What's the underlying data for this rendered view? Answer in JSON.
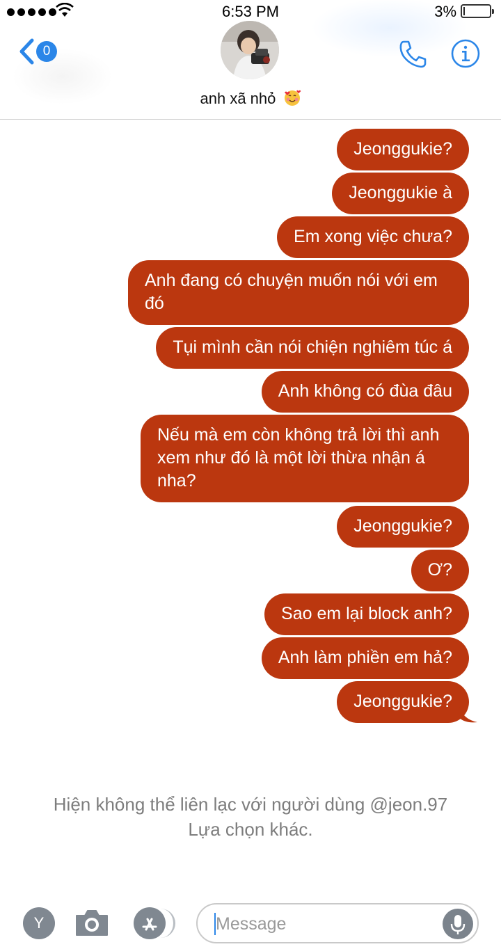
{
  "status_bar": {
    "time": "6:53 PM",
    "battery_percent": "3%",
    "battery_level": 0.03,
    "signal_bars": 5,
    "icons": [
      "signal-dots-icon",
      "wifi-icon",
      "battery-icon"
    ]
  },
  "header": {
    "back_badge_count": "0",
    "contact_name": "anh xã nhỏ",
    "contact_emoji": "smiling-face-with-hearts",
    "icons": [
      "chevron-left-icon",
      "phone-icon",
      "info-icon"
    ],
    "accent_color": "#2b86e8"
  },
  "messages": [
    {
      "text": "Jeonggukie?",
      "from": "me"
    },
    {
      "text": "Jeonggukie à",
      "from": "me"
    },
    {
      "text": "Em xong việc chưa?",
      "from": "me"
    },
    {
      "text": "Anh đang có chuyện muốn nói với em đó",
      "from": "me"
    },
    {
      "text": "Tụi mình cần nói chiện nghiêm túc á",
      "from": "me"
    },
    {
      "text": "Anh không có đùa đâu",
      "from": "me"
    },
    {
      "text": "Nếu mà em còn không trả lời thì anh xem như đó là một lời thừa nhận á nha?",
      "from": "me"
    },
    {
      "text": "Jeonggukie?",
      "from": "me"
    },
    {
      "text": "Ơ?",
      "from": "me"
    },
    {
      "text": "Sao em lại block anh?",
      "from": "me"
    },
    {
      "text": "Anh làm phiền em hả?",
      "from": "me"
    },
    {
      "text": "Jeonggukie?",
      "from": "me"
    }
  ],
  "bubble_color": "#bb370f",
  "notice": {
    "line1": "Hiện không thể liên lạc với người dùng @jeon.97",
    "line2": "Lựa chọn khác."
  },
  "input_bar": {
    "profile_button_label": "Y",
    "placeholder": "Message",
    "icons": [
      "camera-icon",
      "app-store-icon",
      "microphone-icon"
    ]
  }
}
